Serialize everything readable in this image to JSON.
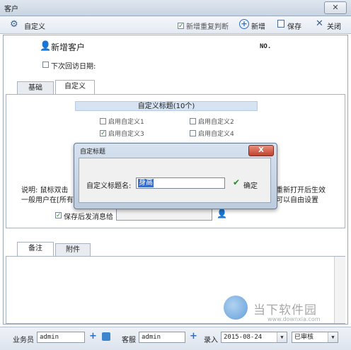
{
  "window": {
    "title": "客户"
  },
  "toolbar": {
    "custom_label": "自定义",
    "dup_check_label": "新增重复判断",
    "dup_check_checked": true,
    "new_label": "新增",
    "save_label": "保存",
    "close_label": "关闭"
  },
  "header": {
    "heading": "新增客户",
    "no_label": "NO.",
    "next_visit_label": "下次回访日期:"
  },
  "tabs_top": [
    {
      "label": "基础"
    },
    {
      "label": "自定义"
    }
  ],
  "custom_panel": {
    "section_title": "自定义标题(10个)",
    "options": [
      {
        "label": "启用自定义1",
        "checked": false
      },
      {
        "label": "启用自定义2",
        "checked": false
      },
      {
        "label": "启用自定义3",
        "checked": true
      },
      {
        "label": "启用自定义4",
        "checked": false
      }
    ],
    "note_line1_left": "说明: 鼠标双击",
    "note_line1_right": "重新打开后生效",
    "note_line2_left": "一般用户在[所有",
    "note_line2_right": "可以自由设置",
    "save_send_label": "保存后发消息给"
  },
  "dialog": {
    "title": "自定标题",
    "close_label": "X",
    "field_label": "自定义标题名:",
    "field_value": "身高",
    "ok_label": "确定"
  },
  "tabs_bottom": [
    {
      "label": "备注"
    },
    {
      "label": "附件"
    }
  ],
  "statusbar": {
    "salesman_label": "业务员",
    "salesman_value": "admin",
    "service_label": "客服",
    "service_value": "admin",
    "entry_label": "录入",
    "entry_date": "2015-08-24",
    "status_value": "已审核"
  },
  "watermark": {
    "brand": "当下软件园",
    "url": "www.downxia.com"
  },
  "colors": {
    "accent": "#2a6fc9",
    "check": "#2b8a2b",
    "section_header": "#d6e3f3"
  }
}
